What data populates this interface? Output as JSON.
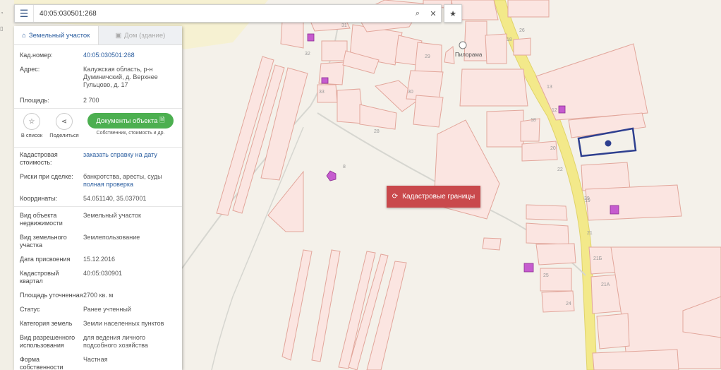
{
  "search": {
    "value": "40:05:030501:268",
    "menu_icon": "menu-icon",
    "search_icon": "search-icon",
    "clear_icon": "close-icon",
    "favorite_icon": "star-icon"
  },
  "tabs": [
    {
      "label": "Земельный участок",
      "icon": "parcel-icon",
      "active": true
    },
    {
      "label": "Дом (здание)",
      "icon": "building-icon",
      "active": false
    }
  ],
  "info_top": [
    {
      "label": "Кад.номер:",
      "value": "40:05:030501:268",
      "link": true
    },
    {
      "label": "Адрес:",
      "value": "Калужская область, р-н Думиничский, д. Верхнее Гульцово, д. 17",
      "link": false
    },
    {
      "label": "Площадь:",
      "value": "2 700",
      "link": false
    }
  ],
  "actions": {
    "to_list": "В список",
    "share": "Поделиться",
    "documents_button": "Документы объекта",
    "documents_sub": "Собственник, стоимость и др."
  },
  "cost": {
    "label": "Кадастровая стоимость:",
    "link": "заказать справку на дату"
  },
  "risks": {
    "label": "Риски при сделке:",
    "text": "банкротства, аресты, суды",
    "link": "полная проверка"
  },
  "coords": {
    "label": "Координаты:",
    "value": "54.051140, 35.037001"
  },
  "details": [
    {
      "label": "Вид объекта недвижимости",
      "value": "Земельный участок"
    },
    {
      "label": "Вид земельного участка",
      "value": "Землепользование"
    },
    {
      "label": "Дата присвоения",
      "value": "15.12.2016"
    },
    {
      "label": "Кадастровый квартал",
      "value": "40:05:030901"
    },
    {
      "label": "Площадь уточненная",
      "value": "2700 кв. м"
    },
    {
      "label": "Статус",
      "value": "Ранее учтенный"
    },
    {
      "label": "Категория земель",
      "value": "Земли населенных пунктов"
    },
    {
      "label": "Вид разрешенного использования",
      "value": "для ведения личного подсобного хозяйства"
    },
    {
      "label": "Форма собственности",
      "value": "Частная"
    }
  ],
  "map_button": {
    "label": "Кадастровые границы",
    "icon": "refresh-icon"
  },
  "map_labels": [
    "Пилорама",
    "32",
    "33",
    "31",
    "30",
    "29",
    "28",
    "39",
    "13",
    "12",
    "18",
    "20",
    "22",
    "19",
    "21",
    "21Б",
    "21А",
    "24",
    "25",
    "18",
    "26",
    "8",
    "16",
    "88"
  ],
  "colors": {
    "accent": "#2a5d9f",
    "green": "#4caf50",
    "red_button": "#c9494c",
    "parcel_fill": "#fbe5e1",
    "parcel_stroke": "#e2a69b",
    "road": "#f3e98a",
    "selected": "#2e3f8f"
  }
}
